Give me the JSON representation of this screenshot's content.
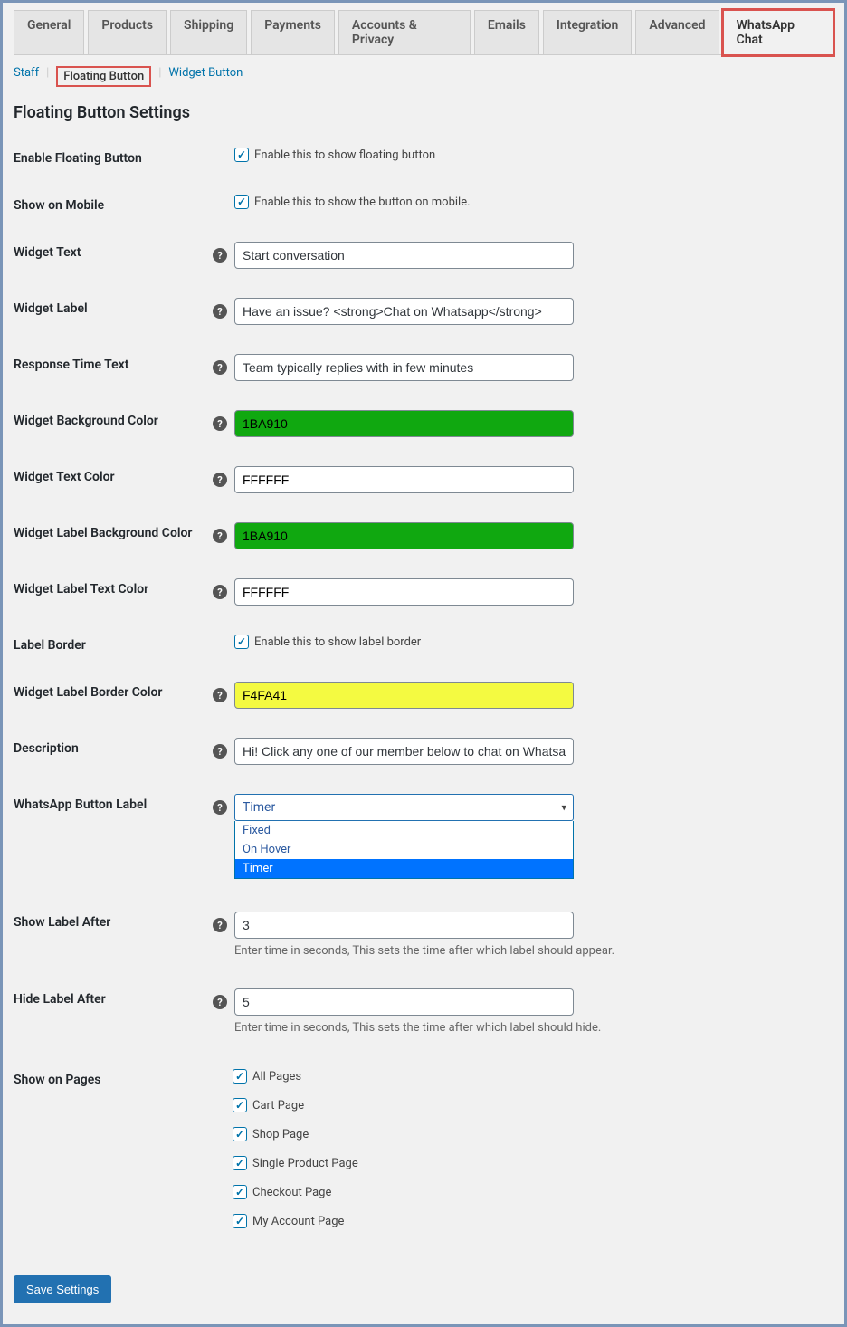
{
  "tabs": {
    "main": [
      "General",
      "Products",
      "Shipping",
      "Payments",
      "Accounts & Privacy",
      "Emails",
      "Integration",
      "Advanced",
      "WhatsApp Chat"
    ],
    "active_index": 8,
    "highlight_index": 8,
    "sub": [
      "Staff",
      "Floating Button",
      "Widget Button"
    ],
    "sub_active_index": 1
  },
  "section_title": "Floating Button Settings",
  "fields": {
    "enable_floating": {
      "label": "Enable Floating Button",
      "text": "Enable this to show floating button",
      "checked": true
    },
    "show_mobile": {
      "label": "Show on Mobile",
      "text": "Enable this to show the button on mobile.",
      "checked": true
    },
    "widget_text": {
      "label": "Widget Text",
      "value": "Start conversation"
    },
    "widget_label": {
      "label": "Widget Label",
      "value": "Have an issue? <strong>Chat on Whatsapp</strong>"
    },
    "response_time": {
      "label": "Response Time Text",
      "value": "Team typically replies with in few minutes"
    },
    "bg_color": {
      "label": "Widget Background Color",
      "value": "1BA910",
      "bg": "#10a810"
    },
    "text_color": {
      "label": "Widget Text Color",
      "value": "FFFFFF",
      "bg": "#ffffff"
    },
    "label_bg_color": {
      "label": "Widget Label Background Color",
      "value": "1BA910",
      "bg": "#10a810"
    },
    "label_text_color": {
      "label": "Widget Label Text Color",
      "value": "FFFFFF",
      "bg": "#ffffff"
    },
    "label_border": {
      "label": "Label Border",
      "text": "Enable this to show label border",
      "checked": true
    },
    "label_border_color": {
      "label": "Widget Label Border Color",
      "value": "F4FA41",
      "bg": "#f4fa41"
    },
    "description": {
      "label": "Description",
      "value": "Hi! Click any one of our member below to chat on Whatsapp"
    },
    "button_label": {
      "label": "WhatsApp Button Label",
      "value": "Timer",
      "options": [
        "Fixed",
        "On Hover",
        "Timer"
      ],
      "selected_index": 2
    },
    "show_after": {
      "label": "Show Label After",
      "value": "3",
      "hint": "Enter time in seconds, This sets the time after which label should appear."
    },
    "hide_after": {
      "label": "Hide Label After",
      "value": "5",
      "hint": "Enter time in seconds, This sets the time after which label should hide."
    },
    "show_pages": {
      "label": "Show on Pages",
      "options": [
        "All Pages",
        "Cart Page",
        "Shop Page",
        "Single Product Page",
        "Checkout Page",
        "My Account Page"
      ]
    }
  },
  "save_button": "Save Settings"
}
